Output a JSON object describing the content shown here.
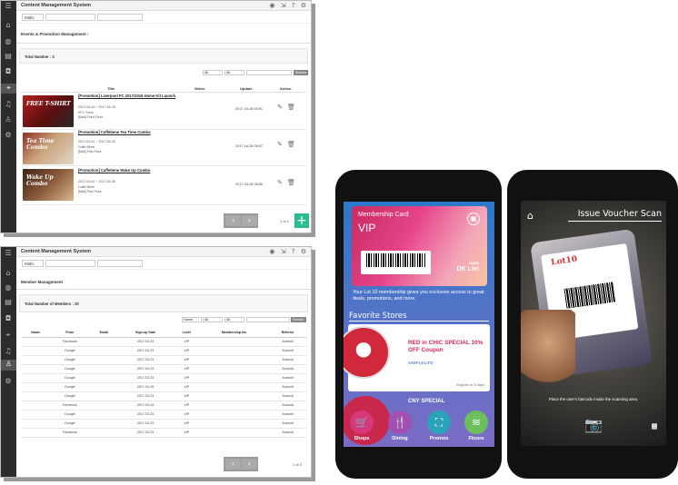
{
  "cms1": {
    "app_title": "Content Management System",
    "filter": {
      "mall": "Malls",
      "sel2": "",
      "sel3": ""
    },
    "section_title": "Events & Promotion Management :",
    "total": "Total Number : 3",
    "search": {
      "sel1": "All",
      "sel2": "All",
      "button": "Search"
    },
    "headers": {
      "title": "Title",
      "writer": "Writer",
      "update": "Update",
      "action": "Action"
    },
    "rows": [
      {
        "thumb_label": "FREE T-SHIRT",
        "title": "[Promotion] Liverpool FC 2017/2018 Home Kit Launch",
        "date_range": "2017-04-20 ~ 2017-05-18",
        "line2": "KFC Store",
        "line3": "[Mall] Third Floor",
        "writer": "",
        "update": "2017-04-28 09:51"
      },
      {
        "thumb_label": "Tea Time Combo",
        "title": "[Promotion] Caffebene Tea Time Combo",
        "date_range": "2017-04-01 ~ 2017-04-30",
        "line2": "Caffe Bene",
        "line3": "[Mall] First Floor",
        "writer": "",
        "update": "2017-04-28 08:57"
      },
      {
        "thumb_label": "Wake Up Combo",
        "title": "[Promotion] Caffebene Wake Up Combo",
        "date_range": "2017-04-01 ~ 2017-04-30",
        "line2": "Caffe Bene",
        "line3": "[Mall] First Floor",
        "writer": "",
        "update": "2017-04-28 08:56"
      }
    ],
    "page_text": "1 of 1"
  },
  "cms2": {
    "app_title": "Content Management System",
    "filter": {
      "mall": "Malls",
      "sel2": "",
      "sel3": ""
    },
    "section_title": "Member Management",
    "total": "Total Number of Members : 20",
    "search": {
      "sel1": "Name",
      "sel2": "All",
      "sel3": "All",
      "button": "Search"
    },
    "headers": [
      "Name",
      "From",
      "Email",
      "Sign-up Date",
      "Level",
      "Membership No.",
      "Referrer"
    ],
    "rows": [
      [
        "",
        "Facebook",
        "",
        "2017-03-23",
        "VIP",
        "",
        "Android"
      ],
      [
        "",
        "Google",
        "",
        "2017-03-23",
        "VIP",
        "",
        "Android"
      ],
      [
        "",
        "Google",
        "",
        "2017-03-23",
        "VIP",
        "",
        "Android"
      ],
      [
        "",
        "Google",
        "",
        "2017-03-23",
        "VIP",
        "",
        "Android"
      ],
      [
        "",
        "Google",
        "",
        "2017-03-23",
        "VIP",
        "",
        "Android"
      ],
      [
        "",
        "Google",
        "",
        "2017-03-26",
        "VIP",
        "",
        "Android"
      ],
      [
        "",
        "Google",
        "",
        "2017-03-23",
        "VIP",
        "",
        "Android"
      ],
      [
        "",
        "Facebook",
        "",
        "2017-03-24",
        "VIP",
        "",
        "Android"
      ],
      [
        "",
        "Google",
        "",
        "2017-03-23",
        "VIP",
        "",
        "Android"
      ],
      [
        "",
        "Google",
        "",
        "2017-03-23",
        "VIP",
        "",
        "Android"
      ],
      [
        "",
        "Facebook",
        "",
        "2017-03-23",
        "VIP",
        "",
        "Android"
      ]
    ],
    "page_text": "1 of 3"
  },
  "phone1": {
    "card_title": "Membership Card",
    "level": "VIP",
    "name_label": "NAME",
    "name_value": "DK Lim",
    "message": "Your Lot 10 membership gives you exclusive access to great deals, promotions, and more.",
    "favorite_title": "Favorite Stores",
    "promo_title": "RED in CHIC SPECIAL 10% OFF Coupon",
    "promo_store": "SIMPLELIFE",
    "promo_expiry": "Expires in 3 days",
    "promo2_title": "CNY SPECIAL",
    "nav": [
      "Shops",
      "Dining",
      "Promos",
      "Floors"
    ]
  },
  "phone2": {
    "title": "Issue Voucher Scan",
    "hint": "Place the user's barcode inside the scanning area."
  },
  "colors": {
    "accent_green": "#2bbd8f",
    "promo_pink": "#d6285a",
    "sidebar": "#2c2c2c"
  }
}
